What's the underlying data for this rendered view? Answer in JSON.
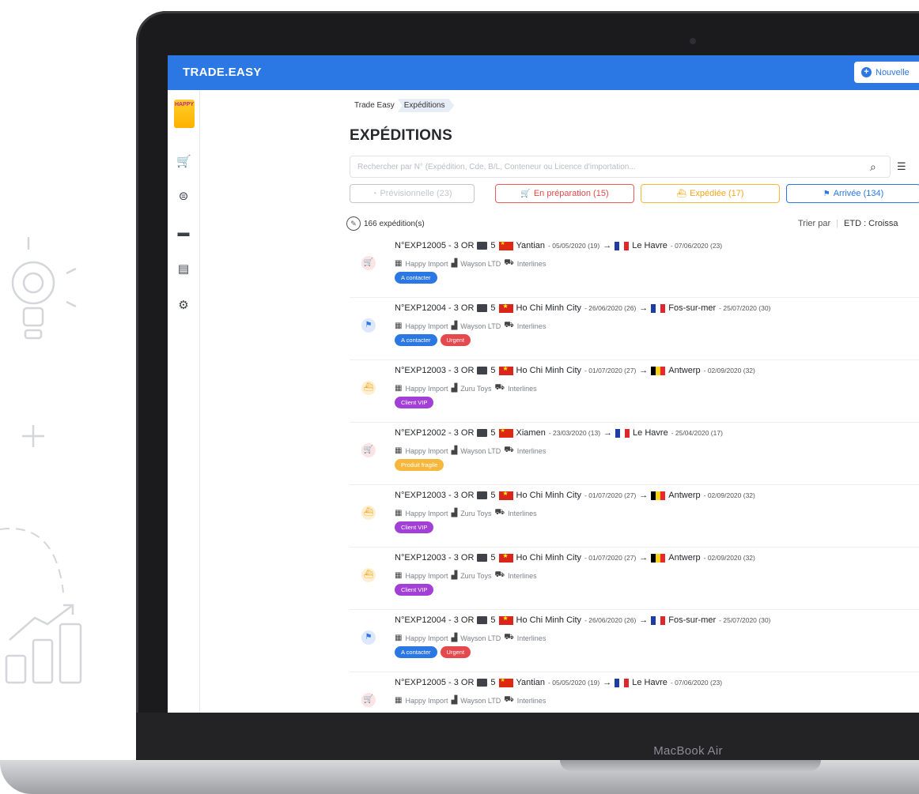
{
  "app": {
    "brand": "TRADE.EASY",
    "new_button_label": "Nouvelle"
  },
  "device": {
    "model": "MacBook Air"
  },
  "sidebar": {
    "logo_text": "HAPPY",
    "items": [
      {
        "icon": "cart-icon"
      },
      {
        "icon": "money-icon"
      },
      {
        "icon": "container-icon"
      },
      {
        "icon": "document-icon"
      },
      {
        "icon": "gear-icon"
      }
    ],
    "expand_label": "»"
  },
  "breadcrumb": [
    "Trade Easy",
    "Expéditions"
  ],
  "page": {
    "title": "EXPÉDITIONS"
  },
  "search": {
    "placeholder": "Rechercher par N° (Expédition, Cde, B/L, Conteneur ou Licence d'importation..."
  },
  "status_tabs": [
    {
      "label": "Prévisionnelle (23)",
      "icon": "clock-icon",
      "color": "#c3c7cc",
      "text": "#c3c7cc"
    },
    {
      "label": "En préparation (15)",
      "icon": "cart-icon",
      "color": "#ef5a5a",
      "text": "#e24a4a"
    },
    {
      "label": "Expédiée (17)",
      "icon": "ship-icon",
      "color": "#f6b73c",
      "text": "#f0a81d"
    },
    {
      "label": "Arrivée (134)",
      "icon": "flag-icon",
      "color": "#2b78e4",
      "text": "#2b78e4"
    }
  ],
  "summary": {
    "count_label": "166 expédition(s)",
    "sort_label": "Trier par",
    "sort_value": "ETD : Croissa"
  },
  "colors": {
    "primary": "#2b78e4",
    "tag_contact": "#2b78e4",
    "tag_urgent": "#e5484d",
    "tag_vip": "#a23fd6",
    "tag_fragile": "#f6b73c"
  },
  "shipments": [
    {
      "status": "prep",
      "id": "N°EXP12005 - 3 OR",
      "qty": "5",
      "from_flag": "cn",
      "from": "Yantian",
      "from_date": "- 05/05/2020 (19)",
      "to_flag": "fr",
      "to": "Le Havre",
      "to_date": "- 07/06/2020 (23)",
      "importer": "Happy Import",
      "supplier": "Wayson LTD",
      "forwarder": "Interlines",
      "tags": [
        {
          "label": "A contacter",
          "color": "#2b78e4"
        }
      ]
    },
    {
      "status": "arrived",
      "id": "N°EXP12004 - 3 OR",
      "qty": "5",
      "from_flag": "vn",
      "from": "Ho Chi Minh City",
      "from_date": "- 26/06/2020 (26)",
      "to_flag": "fr",
      "to": "Fos-sur-mer",
      "to_date": "- 25/07/2020 (30)",
      "importer": "Happy Import",
      "supplier": "Wayson LTD",
      "forwarder": "Interlines",
      "tags": [
        {
          "label": "A contacter",
          "color": "#2b78e4"
        },
        {
          "label": "Urgent",
          "color": "#e5484d"
        }
      ]
    },
    {
      "status": "shipped",
      "id": "N°EXP12003 - 3 OR",
      "qty": "5",
      "from_flag": "vn",
      "from": "Ho Chi Minh City",
      "from_date": "- 01/07/2020 (27)",
      "to_flag": "be",
      "to": "Antwerp",
      "to_date": "- 02/09/2020 (32)",
      "importer": "Happy Import",
      "supplier": "Zuru Toys",
      "forwarder": "Interlines",
      "tags": [
        {
          "label": "Client VIP",
          "color": "#a23fd6"
        }
      ]
    },
    {
      "status": "prep",
      "id": "N°EXP12002 - 3 OR",
      "qty": "5",
      "from_flag": "cn",
      "from": "Xiamen",
      "from_date": "- 23/03/2020 (13)",
      "to_flag": "fr",
      "to": "Le Havre",
      "to_date": "- 25/04/2020 (17)",
      "importer": "Happy Import",
      "supplier": "Wayson LTD",
      "forwarder": "Interlines",
      "tags": [
        {
          "label": "Produit fragile",
          "color": "#f6b73c"
        }
      ]
    },
    {
      "status": "shipped",
      "id": "N°EXP12003 - 3 OR",
      "qty": "5",
      "from_flag": "vn",
      "from": "Ho Chi Minh City",
      "from_date": "- 01/07/2020 (27)",
      "to_flag": "be",
      "to": "Antwerp",
      "to_date": "- 02/09/2020 (32)",
      "importer": "Happy Import",
      "supplier": "Zuru Toys",
      "forwarder": "Interlines",
      "tags": [
        {
          "label": "Client VIP",
          "color": "#a23fd6"
        }
      ]
    },
    {
      "status": "shipped",
      "id": "N°EXP12003 - 3 OR",
      "qty": "5",
      "from_flag": "vn",
      "from": "Ho Chi Minh City",
      "from_date": "- 01/07/2020 (27)",
      "to_flag": "be",
      "to": "Antwerp",
      "to_date": "- 02/09/2020 (32)",
      "importer": "Happy Import",
      "supplier": "Zuru Toys",
      "forwarder": "Interlines",
      "tags": [
        {
          "label": "Client VIP",
          "color": "#a23fd6"
        }
      ]
    },
    {
      "status": "arrived",
      "id": "N°EXP12004 - 3 OR",
      "qty": "5",
      "from_flag": "vn",
      "from": "Ho Chi Minh City",
      "from_date": "- 26/06/2020 (26)",
      "to_flag": "fr",
      "to": "Fos-sur-mer",
      "to_date": "- 25/07/2020 (30)",
      "importer": "Happy Import",
      "supplier": "Wayson LTD",
      "forwarder": "Interlines",
      "tags": [
        {
          "label": "A contacter",
          "color": "#2b78e4"
        },
        {
          "label": "Urgent",
          "color": "#e5484d"
        }
      ]
    },
    {
      "status": "prep",
      "id": "N°EXP12005 - 3 OR",
      "qty": "5",
      "from_flag": "cn",
      "from": "Yantian",
      "from_date": "- 05/05/2020 (19)",
      "to_flag": "fr",
      "to": "Le Havre",
      "to_date": "- 07/06/2020 (23)",
      "importer": "Happy Import",
      "supplier": "Wayson LTD",
      "forwarder": "Interlines",
      "tags": []
    }
  ]
}
